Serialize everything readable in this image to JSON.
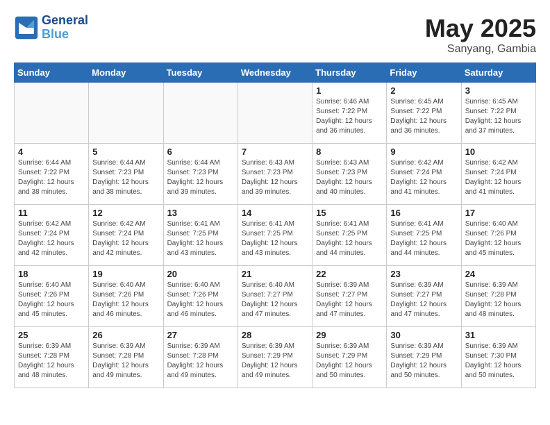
{
  "header": {
    "logo_line1": "General",
    "logo_line2": "Blue",
    "month": "May 2025",
    "location": "Sanyang, Gambia"
  },
  "weekdays": [
    "Sunday",
    "Monday",
    "Tuesday",
    "Wednesday",
    "Thursday",
    "Friday",
    "Saturday"
  ],
  "weeks": [
    [
      {
        "day": "",
        "info": ""
      },
      {
        "day": "",
        "info": ""
      },
      {
        "day": "",
        "info": ""
      },
      {
        "day": "",
        "info": ""
      },
      {
        "day": "1",
        "info": "Sunrise: 6:46 AM\nSunset: 7:22 PM\nDaylight: 12 hours\nand 36 minutes."
      },
      {
        "day": "2",
        "info": "Sunrise: 6:45 AM\nSunset: 7:22 PM\nDaylight: 12 hours\nand 36 minutes."
      },
      {
        "day": "3",
        "info": "Sunrise: 6:45 AM\nSunset: 7:22 PM\nDaylight: 12 hours\nand 37 minutes."
      }
    ],
    [
      {
        "day": "4",
        "info": "Sunrise: 6:44 AM\nSunset: 7:22 PM\nDaylight: 12 hours\nand 38 minutes."
      },
      {
        "day": "5",
        "info": "Sunrise: 6:44 AM\nSunset: 7:23 PM\nDaylight: 12 hours\nand 38 minutes."
      },
      {
        "day": "6",
        "info": "Sunrise: 6:44 AM\nSunset: 7:23 PM\nDaylight: 12 hours\nand 39 minutes."
      },
      {
        "day": "7",
        "info": "Sunrise: 6:43 AM\nSunset: 7:23 PM\nDaylight: 12 hours\nand 39 minutes."
      },
      {
        "day": "8",
        "info": "Sunrise: 6:43 AM\nSunset: 7:23 PM\nDaylight: 12 hours\nand 40 minutes."
      },
      {
        "day": "9",
        "info": "Sunrise: 6:42 AM\nSunset: 7:24 PM\nDaylight: 12 hours\nand 41 minutes."
      },
      {
        "day": "10",
        "info": "Sunrise: 6:42 AM\nSunset: 7:24 PM\nDaylight: 12 hours\nand 41 minutes."
      }
    ],
    [
      {
        "day": "11",
        "info": "Sunrise: 6:42 AM\nSunset: 7:24 PM\nDaylight: 12 hours\nand 42 minutes."
      },
      {
        "day": "12",
        "info": "Sunrise: 6:42 AM\nSunset: 7:24 PM\nDaylight: 12 hours\nand 42 minutes."
      },
      {
        "day": "13",
        "info": "Sunrise: 6:41 AM\nSunset: 7:25 PM\nDaylight: 12 hours\nand 43 minutes."
      },
      {
        "day": "14",
        "info": "Sunrise: 6:41 AM\nSunset: 7:25 PM\nDaylight: 12 hours\nand 43 minutes."
      },
      {
        "day": "15",
        "info": "Sunrise: 6:41 AM\nSunset: 7:25 PM\nDaylight: 12 hours\nand 44 minutes."
      },
      {
        "day": "16",
        "info": "Sunrise: 6:41 AM\nSunset: 7:25 PM\nDaylight: 12 hours\nand 44 minutes."
      },
      {
        "day": "17",
        "info": "Sunrise: 6:40 AM\nSunset: 7:26 PM\nDaylight: 12 hours\nand 45 minutes."
      }
    ],
    [
      {
        "day": "18",
        "info": "Sunrise: 6:40 AM\nSunset: 7:26 PM\nDaylight: 12 hours\nand 45 minutes."
      },
      {
        "day": "19",
        "info": "Sunrise: 6:40 AM\nSunset: 7:26 PM\nDaylight: 12 hours\nand 46 minutes."
      },
      {
        "day": "20",
        "info": "Sunrise: 6:40 AM\nSunset: 7:26 PM\nDaylight: 12 hours\nand 46 minutes."
      },
      {
        "day": "21",
        "info": "Sunrise: 6:40 AM\nSunset: 7:27 PM\nDaylight: 12 hours\nand 47 minutes."
      },
      {
        "day": "22",
        "info": "Sunrise: 6:39 AM\nSunset: 7:27 PM\nDaylight: 12 hours\nand 47 minutes."
      },
      {
        "day": "23",
        "info": "Sunrise: 6:39 AM\nSunset: 7:27 PM\nDaylight: 12 hours\nand 47 minutes."
      },
      {
        "day": "24",
        "info": "Sunrise: 6:39 AM\nSunset: 7:28 PM\nDaylight: 12 hours\nand 48 minutes."
      }
    ],
    [
      {
        "day": "25",
        "info": "Sunrise: 6:39 AM\nSunset: 7:28 PM\nDaylight: 12 hours\nand 48 minutes."
      },
      {
        "day": "26",
        "info": "Sunrise: 6:39 AM\nSunset: 7:28 PM\nDaylight: 12 hours\nand 49 minutes."
      },
      {
        "day": "27",
        "info": "Sunrise: 6:39 AM\nSunset: 7:28 PM\nDaylight: 12 hours\nand 49 minutes."
      },
      {
        "day": "28",
        "info": "Sunrise: 6:39 AM\nSunset: 7:29 PM\nDaylight: 12 hours\nand 49 minutes."
      },
      {
        "day": "29",
        "info": "Sunrise: 6:39 AM\nSunset: 7:29 PM\nDaylight: 12 hours\nand 50 minutes."
      },
      {
        "day": "30",
        "info": "Sunrise: 6:39 AM\nSunset: 7:29 PM\nDaylight: 12 hours\nand 50 minutes."
      },
      {
        "day": "31",
        "info": "Sunrise: 6:39 AM\nSunset: 7:30 PM\nDaylight: 12 hours\nand 50 minutes."
      }
    ]
  ]
}
